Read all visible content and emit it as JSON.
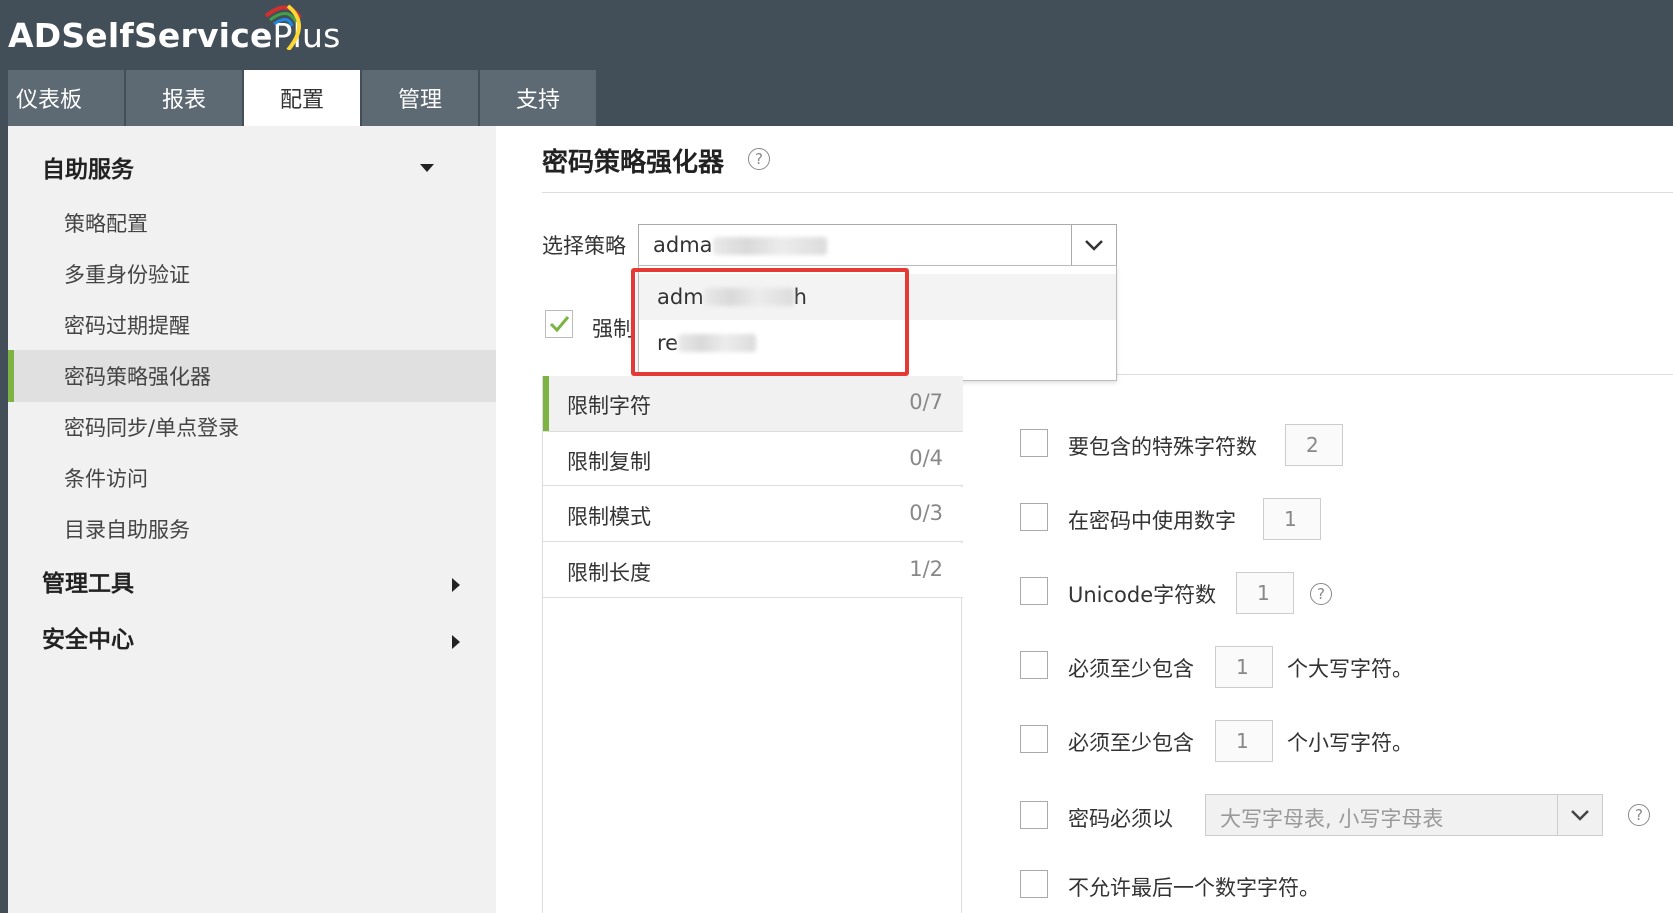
{
  "app": {
    "title_bold": "ADSelfService",
    "title_rest": " Plus"
  },
  "nav": {
    "tabs": [
      {
        "label": "仪表板"
      },
      {
        "label": "报表"
      },
      {
        "label": "配置",
        "active": true
      },
      {
        "label": "管理"
      },
      {
        "label": "支持"
      }
    ]
  },
  "sidebar": {
    "sections": [
      {
        "label": "自助服务",
        "expanded": true
      },
      {
        "label": "管理工具",
        "expanded": false
      },
      {
        "label": "安全中心",
        "expanded": false
      }
    ],
    "items": [
      {
        "label": "策略配置"
      },
      {
        "label": "多重身份验证"
      },
      {
        "label": "密码过期提醒"
      },
      {
        "label": "密码策略强化器",
        "active": true
      },
      {
        "label": "密码同步/单点登录"
      },
      {
        "label": "条件访问"
      },
      {
        "label": "目录自助服务"
      }
    ]
  },
  "main": {
    "title": "密码策略强化器",
    "help_glyph": "?",
    "select_policy_label": "选择策略",
    "selected_policy": "adma",
    "dropdown_options": [
      {
        "prefix": "adm",
        "suffix": "h"
      },
      {
        "prefix": "re",
        "suffix": ""
      }
    ],
    "enforce_label": "强制",
    "enforce_checked": true,
    "categories": [
      {
        "name": "限制字符",
        "count": "0/7",
        "active": true
      },
      {
        "name": "限制复制",
        "count": "0/4"
      },
      {
        "name": "限制模式",
        "count": "0/3"
      },
      {
        "name": "限制长度",
        "count": "1/2"
      }
    ],
    "rules": [
      {
        "label": "要包含的特殊字符数",
        "value": "2"
      },
      {
        "label": "在密码中使用数字",
        "value": "1"
      },
      {
        "label": "Unicode字符数",
        "value": "1"
      },
      {
        "label": "必须至少包含",
        "value": "1",
        "suffix": "个大写字符。"
      },
      {
        "label": "必须至少包含",
        "value": "1",
        "suffix": "个小写字符。"
      },
      {
        "label": "密码必须以",
        "select": "大写字母表, 小写字母表"
      },
      {
        "label": "不允许最后一个数字字符。"
      }
    ]
  },
  "colors": {
    "header": "#434f58",
    "tab": "#5d6973",
    "accent": "#7cb342",
    "highlight": "#e53935"
  }
}
